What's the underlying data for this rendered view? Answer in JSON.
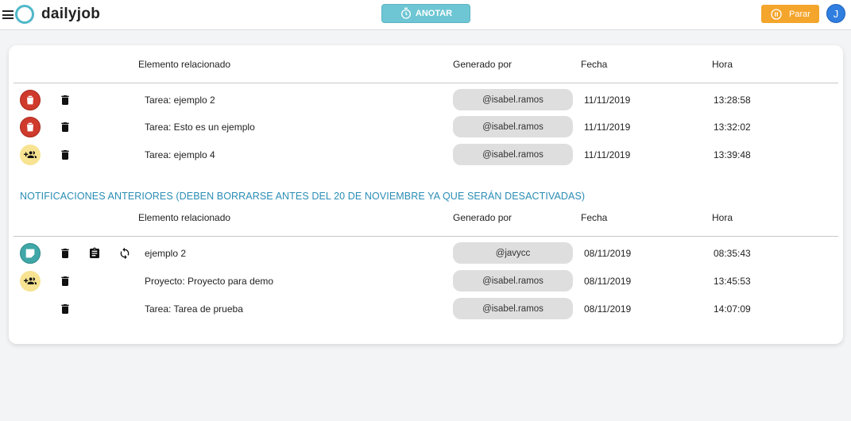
{
  "app": {
    "name": "dailyjob"
  },
  "toolbar": {
    "anotar_label": "ANOTAR",
    "parar_label": "Parar",
    "avatar_initial": "J"
  },
  "columns": {
    "elemento": "Elemento relacionado",
    "generado": "Generado por",
    "fecha": "Fecha",
    "hora": "Hora"
  },
  "current": [
    {
      "type_icon": "trash-icon",
      "elemento": "Tarea: ejemplo 2",
      "user": "@isabel.ramos",
      "fecha": "11/11/2019",
      "hora": "13:28:58"
    },
    {
      "type_icon": "trash-icon",
      "elemento": "Tarea: Esto es un ejemplo",
      "user": "@isabel.ramos",
      "fecha": "11/11/2019",
      "hora": "13:32:02"
    },
    {
      "type_icon": "group-add-icon",
      "elemento": "Tarea: ejemplo 4",
      "user": "@isabel.ramos",
      "fecha": "11/11/2019",
      "hora": "13:39:48"
    }
  ],
  "previous": {
    "title": "NOTIFICACIONES ANTERIORES (DEBEN BORRARSE ANTES DEL 20 DE NOVIEMBRE YA QUE SERÁN DESACTIVADAS)",
    "rows": [
      {
        "type_icon": "note-icon",
        "elemento": "ejemplo 2",
        "user": "@javycc",
        "fecha": "08/11/2019",
        "hora": "08:35:43"
      },
      {
        "type_icon": "group-add-icon",
        "elemento": "Proyecto: Proyecto para demo",
        "user": "@isabel.ramos",
        "fecha": "08/11/2019",
        "hora": "13:45:53"
      },
      {
        "type_icon": "",
        "elemento": "Tarea: Tarea de prueba",
        "user": "@isabel.ramos",
        "fecha": "08/11/2019",
        "hora": "14:07:09"
      }
    ]
  },
  "colors": {
    "accent": "#2a8db5",
    "logo": "#4fb8c9",
    "anotar": "#6ec6d4",
    "parar": "#f4a52c",
    "avatar": "#2f7ee0",
    "red": "#cf3a2c",
    "yellow": "#f7e391",
    "teal": "#3fa7a7"
  }
}
